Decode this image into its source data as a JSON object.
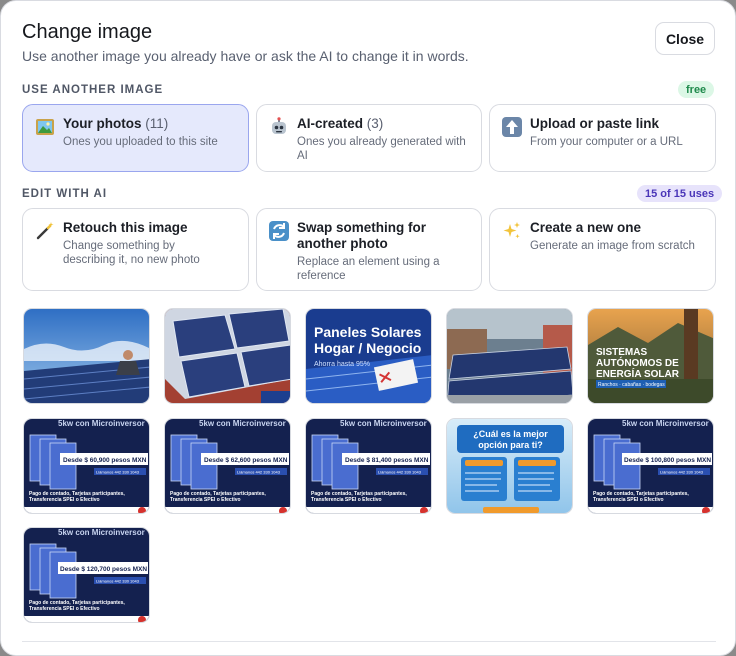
{
  "dialog": {
    "title": "Change image",
    "subtitle": "Use another image you already have or ask the AI to change it in words.",
    "close_label": "Close"
  },
  "use_another": {
    "heading": "USE ANOTHER IMAGE",
    "badge": "free",
    "cards": [
      {
        "title": "Your photos",
        "count": "(11)",
        "desc1": "Ones you uploaded to this site",
        "desc2": "",
        "icon": "photo-icon",
        "selected": true
      },
      {
        "title": "AI-created",
        "count": "(3)",
        "desc1": "Ones you already generated with",
        "desc2": "AI",
        "icon": "robot-icon",
        "selected": false
      },
      {
        "title": "Upload or paste link",
        "count": "",
        "desc1": "From your computer or a URL",
        "desc2": "",
        "icon": "upload-icon",
        "selected": false
      }
    ]
  },
  "edit_ai": {
    "heading": "EDIT WITH AI",
    "badge": "15 of 15 uses",
    "cards": [
      {
        "title1": "Retouch this image",
        "title2": "",
        "desc1": "Change something by",
        "desc2": "describing it, no new photo",
        "icon": "magic-wand-icon"
      },
      {
        "title1": "Swap something for",
        "title2": "another photo",
        "desc1": "Replace an element using a",
        "desc2": "reference",
        "icon": "swap-icon"
      },
      {
        "title1": "Create a new one",
        "title2": "",
        "desc1": "Generate an image from scratch",
        "desc2": "",
        "icon": "sparkles-icon"
      }
    ]
  },
  "thumbnails": {
    "t3_line1": "Paneles Solares",
    "t3_line2": "Hogar / Negocio",
    "t3_line3": "Ahorra hasta 95%",
    "t5_line1": "SISTEMAS",
    "t5_line2": "AUTÓNOMOS DE",
    "t5_line3": "ENERGÍA SOLAR",
    "t5_line4": "Ranchos · cabañas · bodegas",
    "promo_header": "5kw con Microinversor",
    "promo_pay1": "Pago de contado, Tarjetas participantes,",
    "promo_pay2": "Transferencia SPEI o Efectivo",
    "promo_contact": "Llámanos 442 330 1043",
    "price_1": "Desde $ 60,900 pesos MXN",
    "price_2": "Desde $ 62,600 pesos MXN",
    "price_3": "Desde $ 81,400 pesos MXN",
    "price_4": "Desde $ 100,800 pesos MXN",
    "price_5": "Desde $ 120,700 pesos MXN",
    "t9_line1": "¿Cuál es la mejor",
    "t9_line2": "opción para ti?"
  },
  "colors": {
    "accent": "#4a35b8",
    "selected_bg": "#e5e9fc",
    "free_green": "#1f8a4c",
    "promo_navy": "#14214f"
  }
}
